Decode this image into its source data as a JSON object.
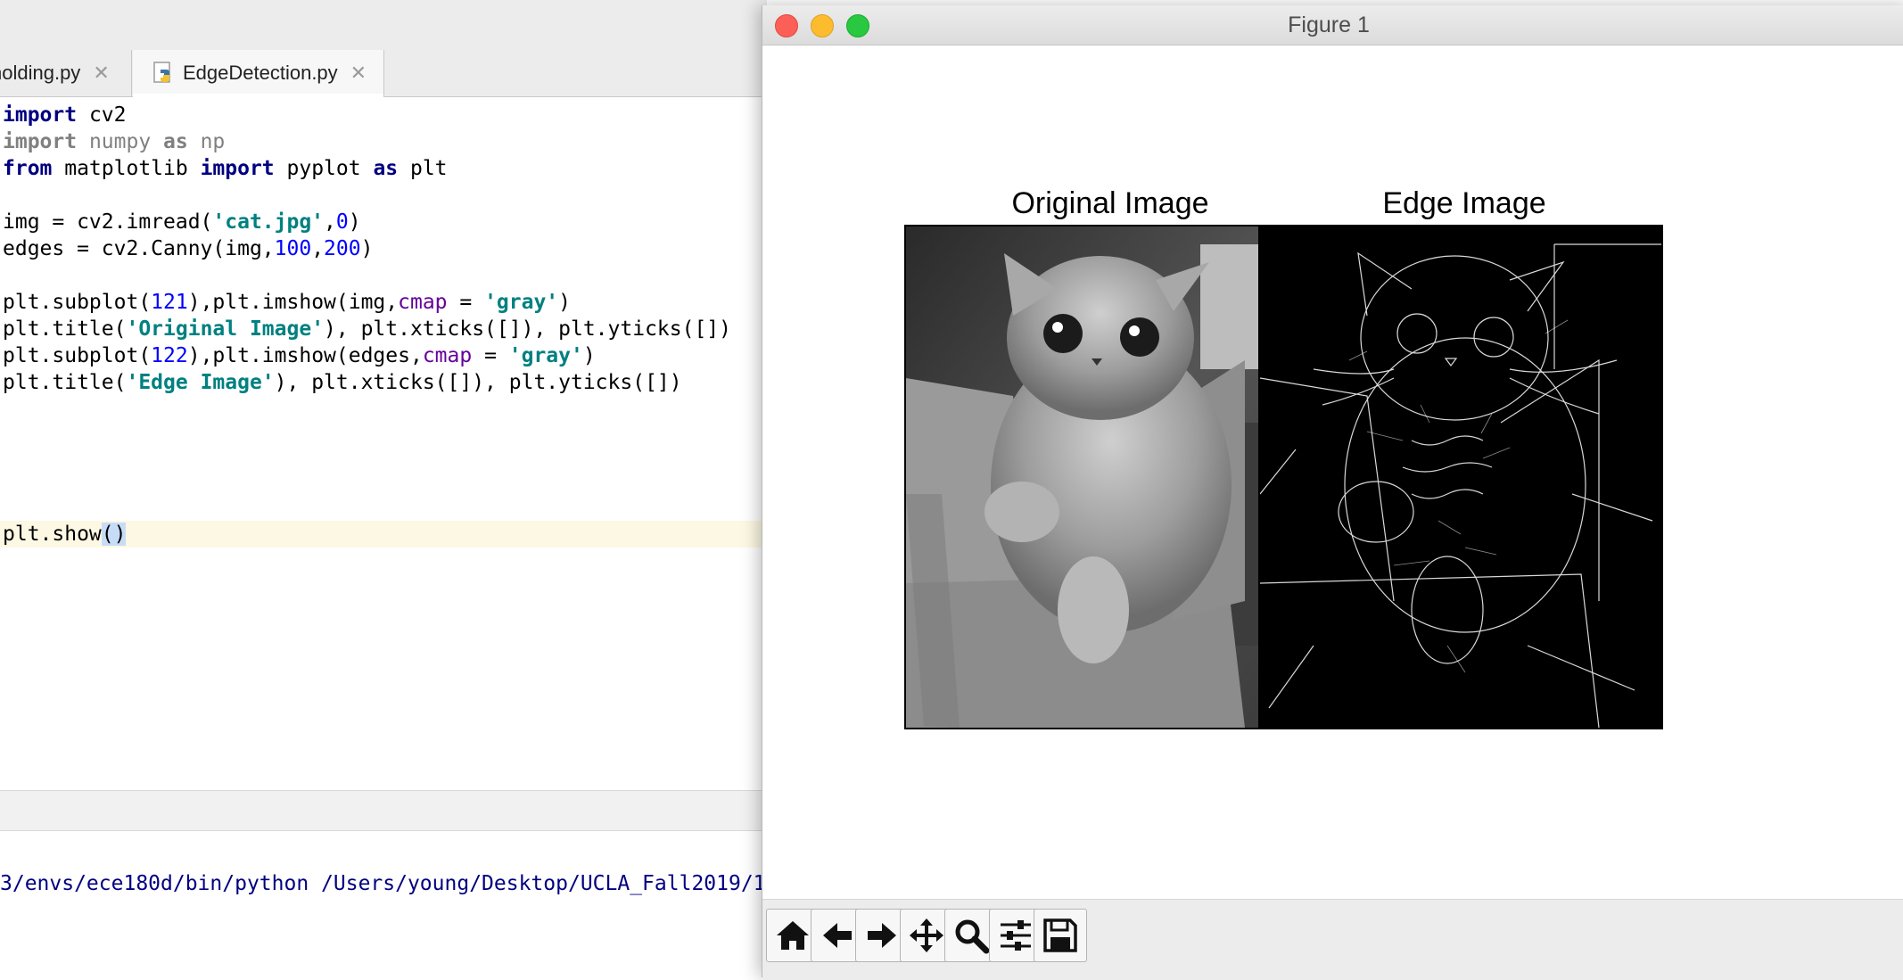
{
  "ide": {
    "tabs": [
      {
        "label": "holding.py"
      },
      {
        "label": "EdgeDetection.py"
      }
    ],
    "close_glyph": "✕",
    "run_command": "3/envs/ece180d/bin/python /Users/young/Desktop/UCLA_Fall2019/1"
  },
  "code": {
    "lines": [
      [
        "import",
        " cv2"
      ],
      [
        "import",
        " numpy ",
        "as",
        " np"
      ],
      [
        "from",
        " matplotlib ",
        "import",
        " pyplot ",
        "as",
        " plt"
      ],
      [],
      [
        "img = cv2.imread(",
        "'cat.jpg'",
        ",",
        "0",
        ")"
      ],
      [
        "edges = cv2.Canny(img,",
        "100",
        ",",
        "200",
        ")"
      ],
      [],
      [
        "plt.subplot(",
        "121",
        "),plt.imshow(img,",
        "cmap",
        " = ",
        "'gray'",
        ")"
      ],
      [
        "plt.title(",
        "'Original Image'",
        "), plt.xticks([]), plt.yticks([])"
      ],
      [
        "plt.subplot(",
        "122",
        "),plt.imshow(edges,",
        "cmap",
        " = ",
        "'gray'",
        ")"
      ],
      [
        "plt.title(",
        "'Edge Image'",
        "), plt.xticks([]), plt.yticks([])"
      ],
      [],
      [
        "plt.show",
        "()"
      ]
    ]
  },
  "figure": {
    "window_title": "Figure 1",
    "panels": [
      {
        "title": "Original Image"
      },
      {
        "title": "Edge Image"
      }
    ],
    "toolbar": [
      {
        "icon": "home-icon"
      },
      {
        "icon": "back-arrow-icon"
      },
      {
        "icon": "forward-arrow-icon"
      },
      {
        "icon": "pan-move-icon"
      },
      {
        "icon": "zoom-magnifier-icon"
      },
      {
        "icon": "configure-subplots-icon"
      },
      {
        "icon": "save-floppy-icon"
      }
    ]
  },
  "colors": {
    "keyword": "#000080",
    "string": "#008080",
    "number": "#0000ff",
    "param": "#660099",
    "close_light": "#fc5f57",
    "minimize_light": "#fdbc2e",
    "maximize_light": "#28c840"
  }
}
